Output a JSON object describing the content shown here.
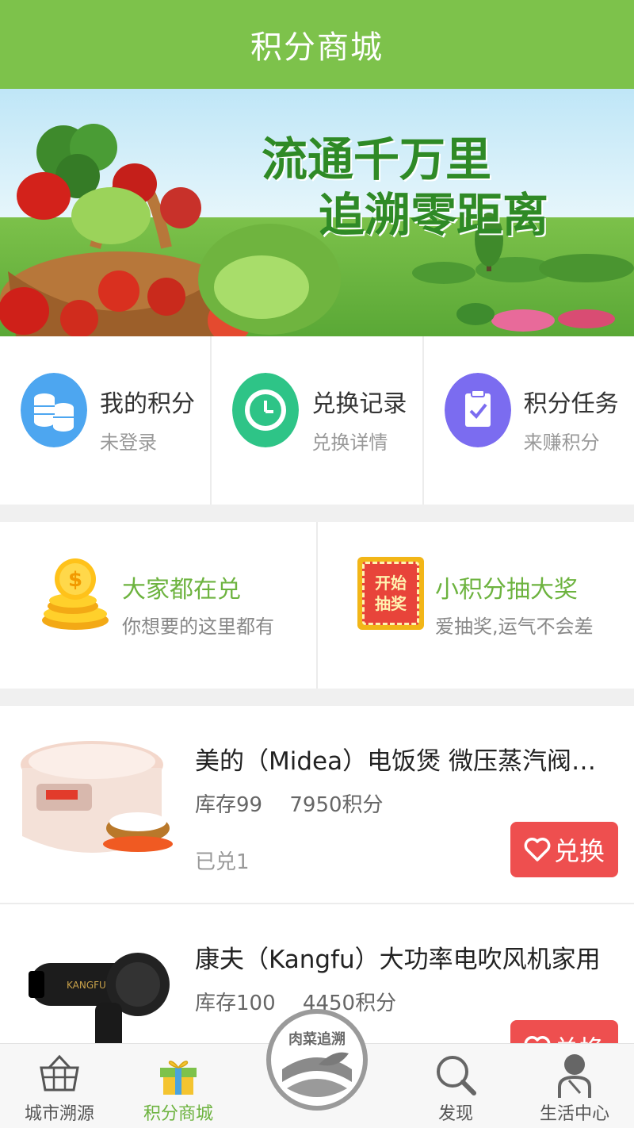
{
  "header": {
    "title": "积分商城"
  },
  "banner": {
    "slogan_line1": "流通千万里",
    "slogan_line2": "追溯零距离"
  },
  "quick_actions": [
    {
      "title": "我的积分",
      "subtitle": "未登录",
      "icon": "coins-stack-icon",
      "color": "#4da6f0"
    },
    {
      "title": "兑换记录",
      "subtitle": "兑换详情",
      "icon": "clock-icon",
      "color": "#2ec487"
    },
    {
      "title": "积分任务",
      "subtitle": "来赚积分",
      "icon": "task-clipboard-icon",
      "color": "#7b6cf0"
    }
  ],
  "promos": [
    {
      "title": "大家都在兑",
      "subtitle": "你想要的这里都有",
      "icon": "gold-coins-icon"
    },
    {
      "title": "小积分抽大奖",
      "subtitle": "爱抽奖,运气不会差",
      "icon": "lottery-icon",
      "badge_line1": "开始",
      "badge_line2": "抽奖"
    }
  ],
  "products": [
    {
      "name": "美的（Midea）电饭煲 微压蒸汽阀电饭锅",
      "stock": "库存99",
      "points": "7950积分",
      "exchanged": "已兑1",
      "button": "兑换"
    },
    {
      "name": "康夫（Kangfu）大功率电吹风机家用",
      "stock": "库存100",
      "points": "4450积分",
      "exchanged": "",
      "button": "兑换"
    }
  ],
  "nav": {
    "items": [
      {
        "label": "城市溯源",
        "icon": "basket-icon"
      },
      {
        "label": "积分商城",
        "icon": "gift-icon",
        "active": true
      },
      {
        "label": "发现",
        "icon": "search-icon"
      },
      {
        "label": "生活中心",
        "icon": "person-icon"
      }
    ],
    "center_logo_text": "肉菜追溯"
  },
  "colors": {
    "brand_green": "#7dc24b",
    "button_red": "#ee4f4f"
  }
}
